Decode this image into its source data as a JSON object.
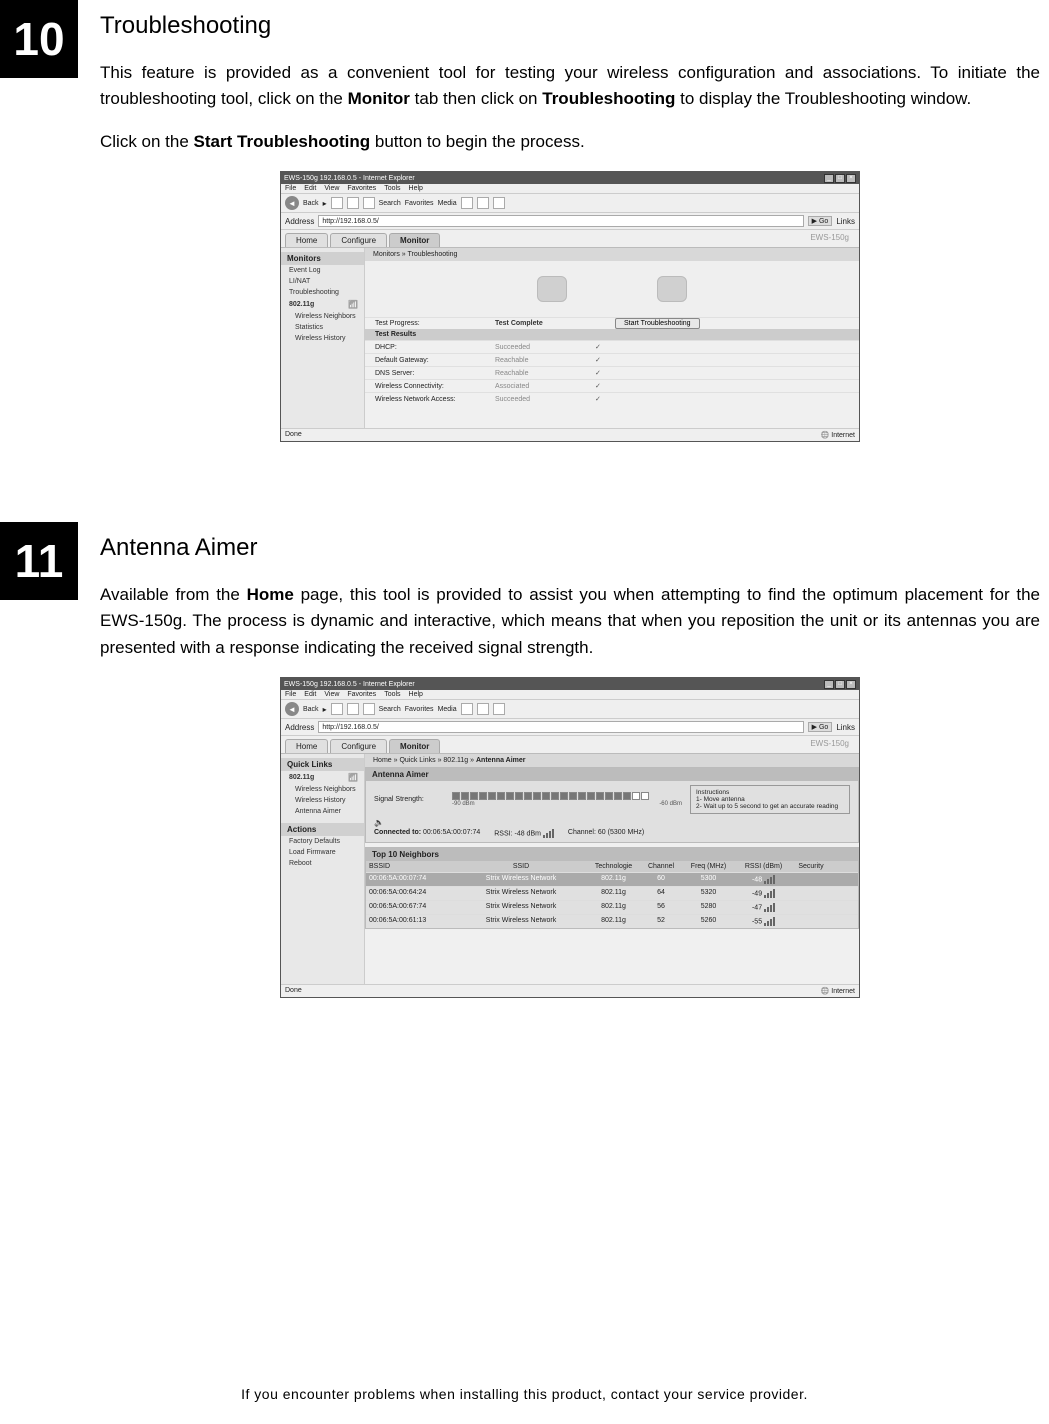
{
  "footer": "If you encounter problems when installing this product, contact your service provider.",
  "section10": {
    "number": "10",
    "title": "Troubleshooting",
    "para1_a": "This feature is provided as a convenient tool for testing your wireless configuration and associations. To initiate the troubleshooting tool, click on the ",
    "para1_b": "Monitor",
    "para1_c": " tab then click on ",
    "para1_d": "Troubleshooting",
    "para1_e": " to display the Troubleshooting window.",
    "para2_a": "Click on the ",
    "para2_b": "Start Troubleshooting",
    "para2_c": " button to begin the process."
  },
  "section11": {
    "number": "11",
    "title": "Antenna Aimer",
    "para1_a": "Available from the ",
    "para1_b": "Home",
    "para1_c": " page, this tool is provided to assist you when attempting to find the optimum placement for the EWS-150g. The process is dynamic and interactive, which means that when you reposition the unit or its antennas you are presented with a response indicating the received signal strength."
  },
  "ie_common": {
    "title_prefix": "EWS-150g 192.168.0.5 - Internet Explorer",
    "menu_file": "File",
    "menu_edit": "Edit",
    "menu_view": "View",
    "menu_fav": "Favorites",
    "menu_tools": "Tools",
    "menu_help": "Help",
    "back": "Back",
    "search": "Search",
    "favorites": "Favorites",
    "media": "Media",
    "addr_label": "Address",
    "addr_url": "http://192.168.0.5/",
    "go": "Go",
    "links": "Links",
    "device": "EWS-150g",
    "tab_home": "Home",
    "tab_configure": "Configure",
    "tab_monitor": "Monitor",
    "status_done": "Done",
    "status_zone": "Internet",
    "win_min": "_",
    "win_max": "□",
    "win_close": "×"
  },
  "screenshot1": {
    "breadcrumb": "Monitors » Troubleshooting",
    "side_head": "Monitors",
    "side_eventlog": "Event Log",
    "side_linat": "LI/NAT",
    "side_ts": "Troubleshooting",
    "side_radio": "802.11g",
    "side_wn": "Wireless Neighbors",
    "side_stats": "Statistics",
    "side_wh": "Wireless History",
    "progress_label": "Test Progress:",
    "progress_value": "Test Complete",
    "start_btn": "Start Troubleshooting",
    "results_head": "Test Results",
    "rows": [
      {
        "label": "DHCP:",
        "value": "Succeeded"
      },
      {
        "label": "Default Gateway:",
        "value": "Reachable"
      },
      {
        "label": "DNS Server:",
        "value": "Reachable"
      },
      {
        "label": "Wireless Connectivity:",
        "value": "Associated"
      },
      {
        "label": "Wireless Network Access:",
        "value": "Succeeded"
      }
    ],
    "check": "✓"
  },
  "screenshot2": {
    "breadcrumb_a": "Home » Quick Links » 802.11g » ",
    "breadcrumb_b": "Antenna Aimer",
    "side_ql": "Quick Links",
    "side_radio": "802.11g",
    "side_wn": "Wireless Neighbors",
    "side_wh": "Wireless History",
    "side_aa": "Antenna Aimer",
    "side_actions": "Actions",
    "side_fd": "Factory Defaults",
    "side_lf": "Load Firmware",
    "side_reboot": "Reboot",
    "aa_head": "Antenna Aimer",
    "sig_label": "Signal Strength:",
    "scale_left": "-90 dBm",
    "scale_right": "-60 dBm",
    "instr_head": "Instructions",
    "instr_1": "1- Move antenna",
    "instr_2": "2- Wait up to 5 second to get an accurate reading",
    "conn_label": "Connected to:",
    "conn_bssid": "00:06:5A:00:07:74",
    "conn_rssi_label": "RSSI:",
    "conn_rssi": "-48 dBm",
    "conn_chan_label": "Channel:",
    "conn_chan": "60 (5300 MHz)",
    "top10_head": "Top 10 Neighbors",
    "th_bssid": "BSSID",
    "th_ssid": "SSID",
    "th_tech": "Technologie",
    "th_chan": "Channel",
    "th_freq": "Freq (MHz)",
    "th_rssi": "RSSI (dBm)",
    "th_sec": "Security",
    "rows": [
      {
        "bssid": "00:06:5A:00:07:74",
        "ssid": "Strix Wireless Network",
        "tech": "802.11g",
        "chan": "60",
        "freq": "5300",
        "rssi": "-48",
        "hl": true
      },
      {
        "bssid": "00:06:5A:00:64:24",
        "ssid": "Strix Wireless Network",
        "tech": "802.11g",
        "chan": "64",
        "freq": "5320",
        "rssi": "-49",
        "hl": false
      },
      {
        "bssid": "00:06:5A:00:67:74",
        "ssid": "Strix Wireless Network",
        "tech": "802.11g",
        "chan": "56",
        "freq": "5280",
        "rssi": "-47",
        "hl": false
      },
      {
        "bssid": "00:06:5A:00:61:13",
        "ssid": "Strix Wireless Network",
        "tech": "802.11g",
        "chan": "52",
        "freq": "5260",
        "rssi": "-55",
        "hl": false
      }
    ]
  }
}
